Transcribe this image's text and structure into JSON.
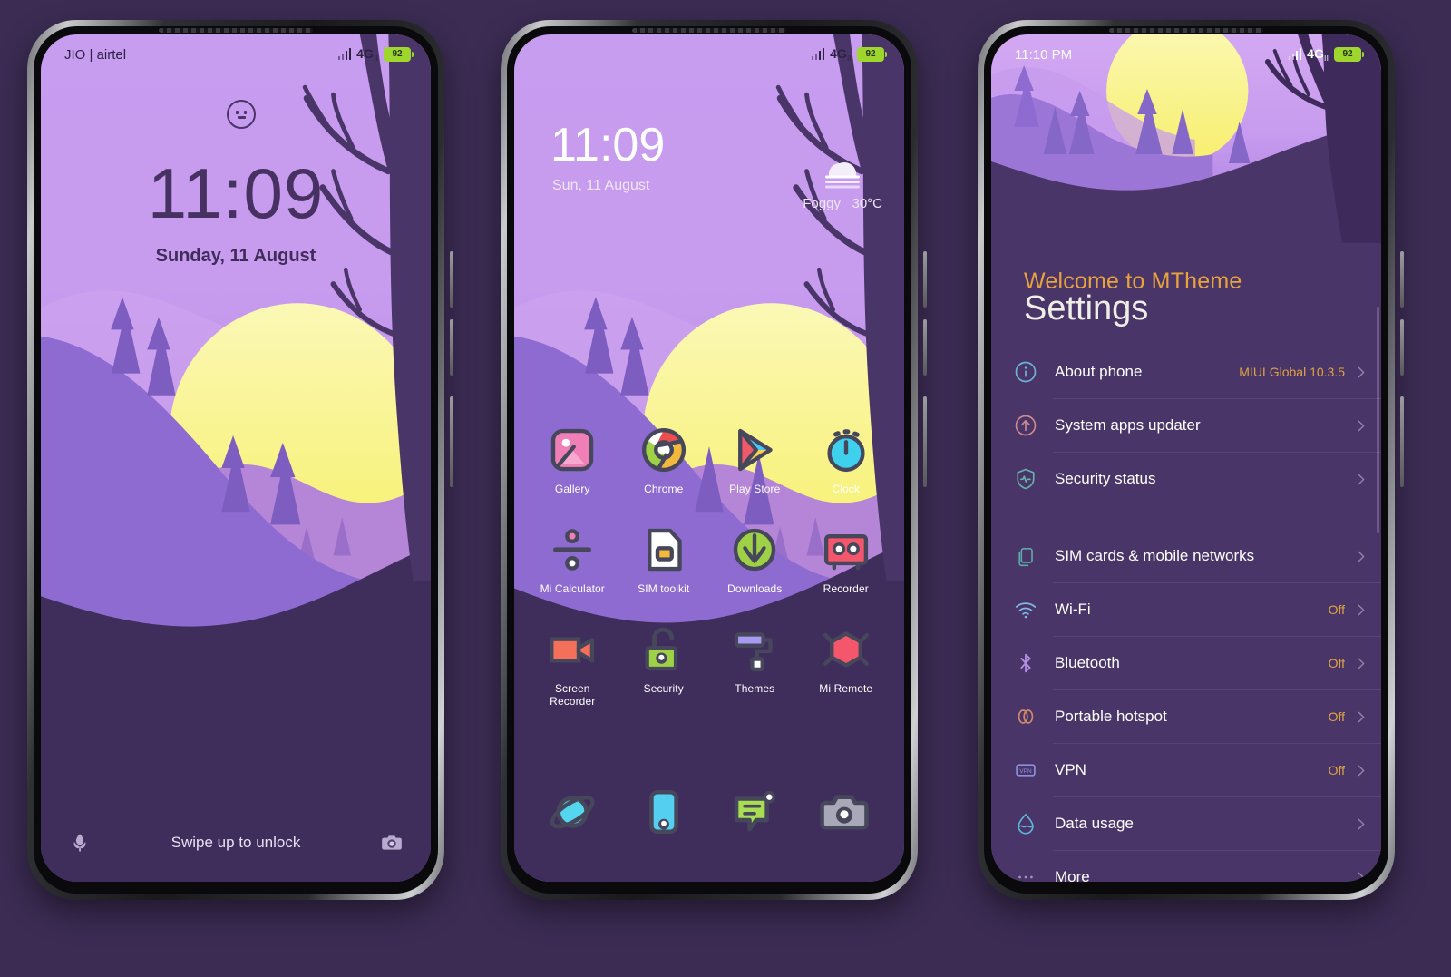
{
  "theme": {
    "accent_orange": "#e8a33d",
    "page_background": "#3c2c54",
    "settings_background": "#4a3569",
    "battery_green": "#9fd62e",
    "wallpaper_sky": "#c79df0",
    "wallpaper_sun": "#f6f07f"
  },
  "lockscreen": {
    "statusbar": {
      "carrier": "JIO | airtel",
      "network": "4G",
      "network_sub": "ll",
      "battery": "92"
    },
    "time": "11:09",
    "date": "Sunday, 11 August",
    "hint": "Swipe up to unlock",
    "left_shortcut": "flashlight-icon",
    "right_shortcut": "camera-icon",
    "notification_icon": "smiley-face-icon"
  },
  "homescreen": {
    "statusbar": {
      "carrier": "",
      "network": "4G",
      "network_sub": "ll",
      "battery": "92"
    },
    "time": "11:09",
    "date": "Sun, 11 August",
    "weather": {
      "condition": "Foggy",
      "temperature": "30°C",
      "icon": "fog-cloud-icon"
    },
    "rows": [
      [
        {
          "label": "Gallery",
          "icon": "gallery-icon"
        },
        {
          "label": "Chrome",
          "icon": "chrome-icon"
        },
        {
          "label": "Play Store",
          "icon": "play-store-icon"
        },
        {
          "label": "Clock",
          "icon": "clock-icon"
        }
      ],
      [
        {
          "label": "Mi Calculator",
          "icon": "calculator-divide-icon"
        },
        {
          "label": "SIM toolkit",
          "icon": "sim-card-icon"
        },
        {
          "label": "Downloads",
          "icon": "download-arrow-icon"
        },
        {
          "label": "Recorder",
          "icon": "cassette-tape-icon"
        }
      ],
      [
        {
          "label": "Screen Recorder",
          "icon": "video-camera-icon"
        },
        {
          "label": "Security",
          "icon": "unlocked-padlock-icon"
        },
        {
          "label": "Themes",
          "icon": "paint-roller-icon"
        },
        {
          "label": "Mi Remote",
          "icon": "remote-hexagon-icon"
        }
      ]
    ],
    "dock": [
      {
        "label": "Browser",
        "icon": "planet-browser-icon"
      },
      {
        "label": "Phone",
        "icon": "phone-dialer-icon"
      },
      {
        "label": "Messaging",
        "icon": "message-bubble-icon"
      },
      {
        "label": "Camera",
        "icon": "camera-icon"
      }
    ]
  },
  "settings": {
    "statusbar": {
      "time": "11:10 PM",
      "network": "4G",
      "network_sub": "ll",
      "battery": "92"
    },
    "welcome": "Welcome to MTheme",
    "title": "Settings",
    "groups": [
      {
        "items": [
          {
            "label": "About phone",
            "value": "MIUI Global 10.3.5",
            "icon": "info-circle-icon"
          },
          {
            "label": "System apps updater",
            "value": "",
            "icon": "update-arrow-icon"
          },
          {
            "label": "Security status",
            "value": "",
            "icon": "shield-pulse-icon"
          }
        ]
      },
      {
        "items": [
          {
            "label": "SIM cards & mobile networks",
            "value": "",
            "icon": "sim-cards-icon"
          },
          {
            "label": "Wi-Fi",
            "value": "Off",
            "icon": "wifi-icon"
          },
          {
            "label": "Bluetooth",
            "value": "Off",
            "icon": "bluetooth-icon"
          },
          {
            "label": "Portable hotspot",
            "value": "Off",
            "icon": "hotspot-rings-icon"
          },
          {
            "label": "VPN",
            "value": "Off",
            "icon": "vpn-badge-icon"
          },
          {
            "label": "Data usage",
            "value": "",
            "icon": "data-droplet-icon"
          },
          {
            "label": "More",
            "value": "",
            "icon": "more-dots-icon"
          }
        ]
      }
    ]
  }
}
